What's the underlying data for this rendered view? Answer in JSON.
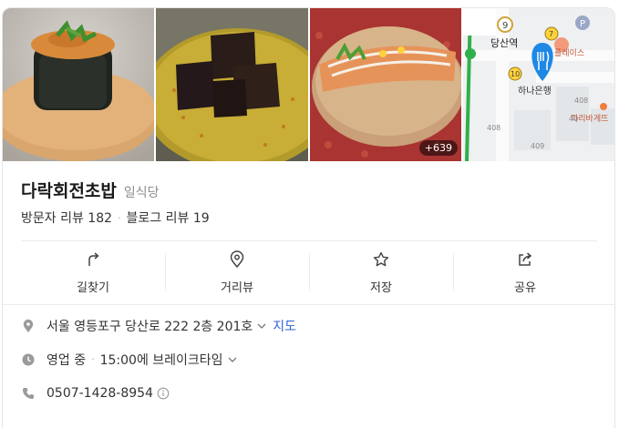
{
  "photos": {
    "more_count": "+639",
    "map_labels": {
      "station_name": "당산역",
      "station_num_9": "9",
      "station_num_7": "7",
      "station_num_10": "10",
      "bank": "하나은행",
      "place_1": "플레이스",
      "place_2": "파리바게뜨",
      "building_408a": "408",
      "building_408b": "408",
      "building_409": "409",
      "building_40": "40",
      "parking": "P"
    }
  },
  "place": {
    "name": "다락회전초밥",
    "category": "일식당",
    "visitor_reviews": "방문자 리뷰 182",
    "blog_reviews": "블로그 리뷰 19"
  },
  "actions": [
    {
      "label": "길찾기",
      "icon": "directions-icon"
    },
    {
      "label": "거리뷰",
      "icon": "streetview-pin-icon"
    },
    {
      "label": "저장",
      "icon": "star-icon"
    },
    {
      "label": "공유",
      "icon": "share-icon"
    }
  ],
  "info": {
    "address": "서울 영등포구 당산로 222 2층 201호",
    "map_link": "지도",
    "hours_status": "영업 중",
    "hours_detail": "15:00에 브레이크타임",
    "phone": "0507-1428-8954"
  },
  "colors": {
    "link": "#2d62d8",
    "map_pin": "#1e88e5",
    "icon_gray": "#8c8c8c"
  }
}
